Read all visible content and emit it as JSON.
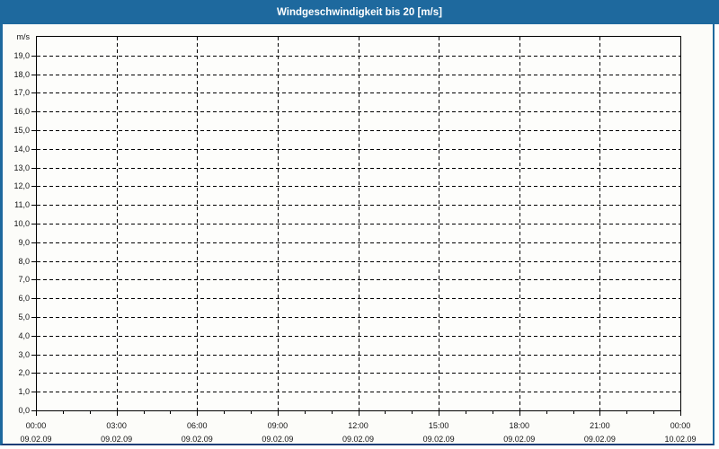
{
  "window": {
    "title": "Windgeschwindigkeit bis 20 [m/s]"
  },
  "colors": {
    "titlebar_bg": "#1e699e",
    "frame_border": "#1e699e",
    "frame_border_bottom": "#1d3d77",
    "panel_bg": "#fcfcf9",
    "plot_bg": "#fdfdfb",
    "grid": "#000000",
    "axis": "#000000",
    "label": "#141414"
  },
  "chart_data": {
    "type": "line",
    "title": "Windgeschwindigkeit bis 20 [m/s]",
    "ylabel": "m/s",
    "ylim": [
      0,
      20
    ],
    "y_tick_step": 1,
    "y_tick_labels": [
      "0,0",
      "1,0",
      "2,0",
      "3,0",
      "4,0",
      "5,0",
      "6,0",
      "7,0",
      "8,0",
      "9,0",
      "10,0",
      "11,0",
      "12,0",
      "13,0",
      "14,0",
      "15,0",
      "16,0",
      "17,0",
      "18,0",
      "19,0"
    ],
    "x_span_hours": 24,
    "x_major_every_hours": 3,
    "x_minor_every_hours": 1,
    "x_major_labels": [
      {
        "time": "00:00",
        "date": "09.02.09"
      },
      {
        "time": "03:00",
        "date": "09.02.09"
      },
      {
        "time": "06:00",
        "date": "09.02.09"
      },
      {
        "time": "09:00",
        "date": "09.02.09"
      },
      {
        "time": "12:00",
        "date": "09.02.09"
      },
      {
        "time": "15:00",
        "date": "09.02.09"
      },
      {
        "time": "18:00",
        "date": "09.02.09"
      },
      {
        "time": "21:00",
        "date": "09.02.09"
      },
      {
        "time": "00:00",
        "date": "10.02.09"
      }
    ],
    "grid": true,
    "legend_position": "none",
    "series": []
  }
}
